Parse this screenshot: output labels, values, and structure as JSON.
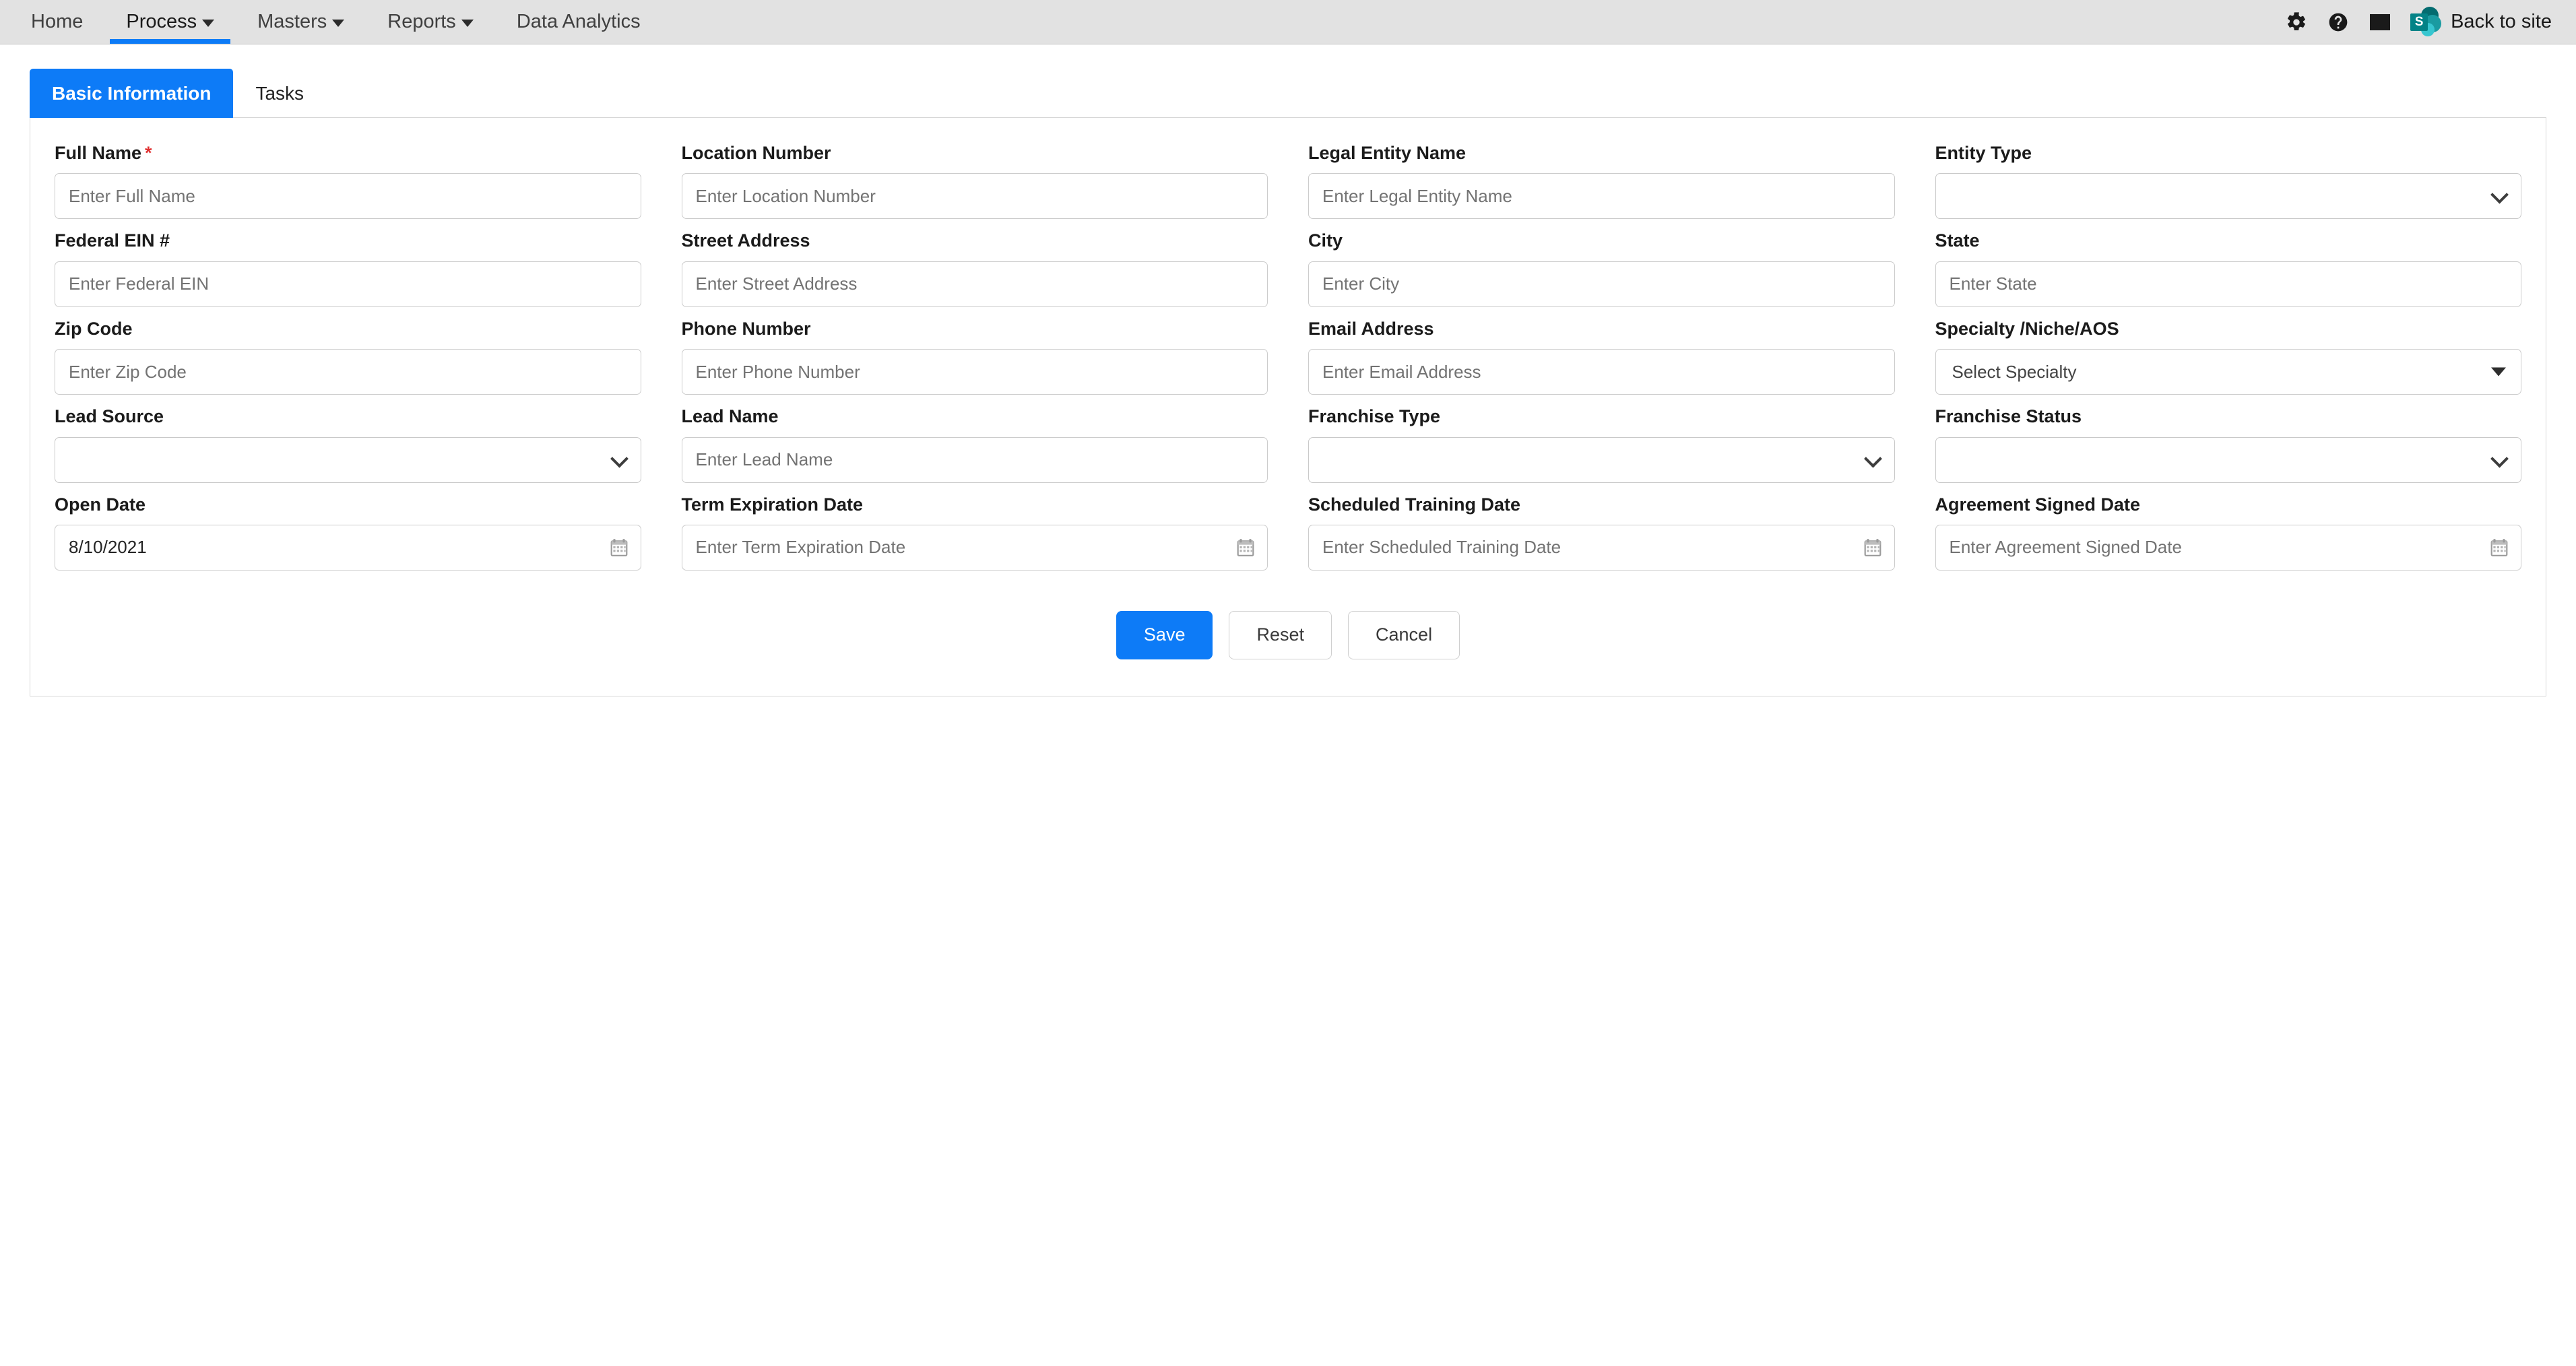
{
  "navbar": {
    "items": [
      {
        "label": "Home",
        "has_caret": false,
        "active": false
      },
      {
        "label": "Process",
        "has_caret": true,
        "active": true
      },
      {
        "label": "Masters",
        "has_caret": true,
        "active": false
      },
      {
        "label": "Reports",
        "has_caret": true,
        "active": false
      },
      {
        "label": "Data Analytics",
        "has_caret": false,
        "active": false
      }
    ],
    "icons": [
      {
        "name": "gear-icon"
      },
      {
        "name": "help-circle-icon"
      },
      {
        "name": "envelope-icon"
      }
    ],
    "sharepoint": {
      "logo_letter": "S",
      "label": "Back to site"
    }
  },
  "tabs": [
    {
      "label": "Basic Information",
      "active": true
    },
    {
      "label": "Tasks",
      "active": false
    }
  ],
  "form": {
    "fields": [
      {
        "label": "Full Name",
        "required": true,
        "type": "text",
        "placeholder": "Enter Full Name",
        "value": ""
      },
      {
        "label": "Location Number",
        "required": false,
        "type": "text",
        "placeholder": "Enter Location Number",
        "value": ""
      },
      {
        "label": "Legal Entity Name",
        "required": false,
        "type": "text",
        "placeholder": "Enter Legal Entity Name",
        "value": ""
      },
      {
        "label": "Entity Type",
        "required": false,
        "type": "native-select",
        "placeholder": "",
        "value": ""
      },
      {
        "label": "Federal EIN #",
        "required": false,
        "type": "text",
        "placeholder": "Enter Federal EIN",
        "value": ""
      },
      {
        "label": "Street Address",
        "required": false,
        "type": "text",
        "placeholder": "Enter Street Address",
        "value": ""
      },
      {
        "label": "City",
        "required": false,
        "type": "text",
        "placeholder": "Enter City",
        "value": ""
      },
      {
        "label": "State",
        "required": false,
        "type": "text",
        "placeholder": "Enter State",
        "value": ""
      },
      {
        "label": "Zip Code",
        "required": false,
        "type": "text",
        "placeholder": "Enter Zip Code",
        "value": ""
      },
      {
        "label": "Phone Number",
        "required": false,
        "type": "text",
        "placeholder": "Enter Phone Number",
        "value": ""
      },
      {
        "label": "Email Address",
        "required": false,
        "type": "text",
        "placeholder": "Enter Email Address",
        "value": ""
      },
      {
        "label": "Specialty /Niche/AOS",
        "required": false,
        "type": "custom-select",
        "placeholder": "Select Specialty",
        "value": ""
      },
      {
        "label": "Lead Source",
        "required": false,
        "type": "native-select",
        "placeholder": "",
        "value": ""
      },
      {
        "label": "Lead Name",
        "required": false,
        "type": "text",
        "placeholder": "Enter Lead Name",
        "value": ""
      },
      {
        "label": "Franchise Type",
        "required": false,
        "type": "native-select",
        "placeholder": "",
        "value": ""
      },
      {
        "label": "Franchise Status",
        "required": false,
        "type": "native-select",
        "placeholder": "",
        "value": ""
      },
      {
        "label": "Open Date",
        "required": false,
        "type": "date",
        "placeholder": "Enter Open Date",
        "value": "8/10/2021"
      },
      {
        "label": "Term Expiration Date",
        "required": false,
        "type": "date",
        "placeholder": "Enter Term Expiration Date",
        "value": ""
      },
      {
        "label": "Scheduled Training Date",
        "required": false,
        "type": "date",
        "placeholder": "Enter Scheduled Training Date",
        "value": ""
      },
      {
        "label": "Agreement Signed Date",
        "required": false,
        "type": "date",
        "placeholder": "Enter Agreement Signed Date",
        "value": ""
      }
    ],
    "buttons": [
      {
        "label": "Save",
        "style": "primary"
      },
      {
        "label": "Reset",
        "style": "secondary"
      },
      {
        "label": "Cancel",
        "style": "secondary"
      }
    ]
  },
  "colors": {
    "accent": "#0d7bf7",
    "required_asterisk": "#e03030",
    "navbar_bg": "#e2e2e2",
    "sharepoint_teal": "#038387"
  }
}
